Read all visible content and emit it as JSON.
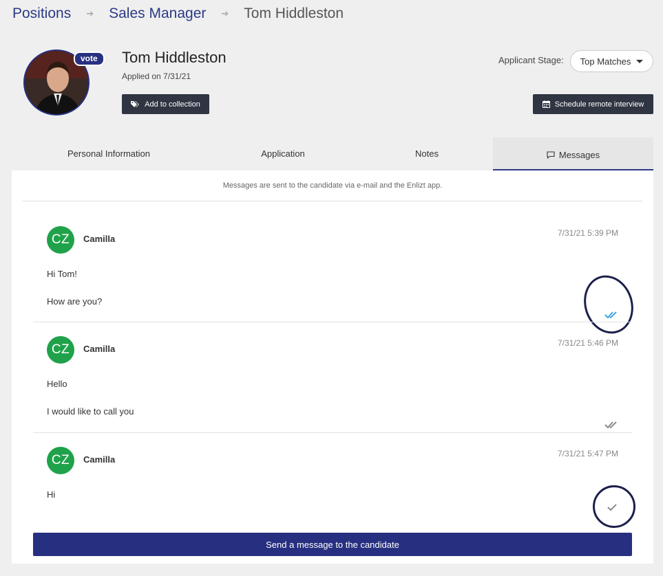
{
  "breadcrumb": {
    "items": [
      "Positions",
      "Sales Manager",
      "Tom Hiddleston"
    ]
  },
  "candidate": {
    "name": "Tom Hiddleston",
    "applied": "Applied on 7/31/21",
    "vote_badge": "vote",
    "add_collection_label": "Add to collection"
  },
  "stage": {
    "label": "Applicant Stage:",
    "value": "Top Matches"
  },
  "schedule_label": "Schedule remote interview",
  "tabs": [
    {
      "label": "Personal Information"
    },
    {
      "label": "Application"
    },
    {
      "label": "Notes"
    },
    {
      "label": "Messages",
      "active": true
    }
  ],
  "messages_note": "Messages are sent to the candidate via e-mail and the Enlizt app.",
  "messages": [
    {
      "initials": "CZ",
      "author": "Camilla",
      "time": "7/31/21 5:39 PM",
      "lines": [
        "Hi Tom!",
        "How are you?"
      ],
      "status": "read"
    },
    {
      "initials": "CZ",
      "author": "Camilla",
      "time": "7/31/21 5:46 PM",
      "lines": [
        "Hello",
        "I would like to call you"
      ],
      "status": "delivered"
    },
    {
      "initials": "CZ",
      "author": "Camilla",
      "time": "7/31/21 5:47 PM",
      "lines": [
        "Hi"
      ],
      "status": "sent"
    }
  ],
  "send_button_label": "Send a message to the candidate",
  "colors": {
    "brand": "#273080",
    "avatar_green": "#1fa24a",
    "read_check": "#3aa6dd",
    "unread_check": "#8a8a8a",
    "dark_button": "#2f3542"
  },
  "icons": {
    "tag": "tag-icon",
    "calendar": "calendar-icon",
    "chat": "chat-bubble-icon",
    "breadcrumb_arrow": "arrow-right-icon",
    "check": "check-icon",
    "double_check": "double-check-icon"
  }
}
